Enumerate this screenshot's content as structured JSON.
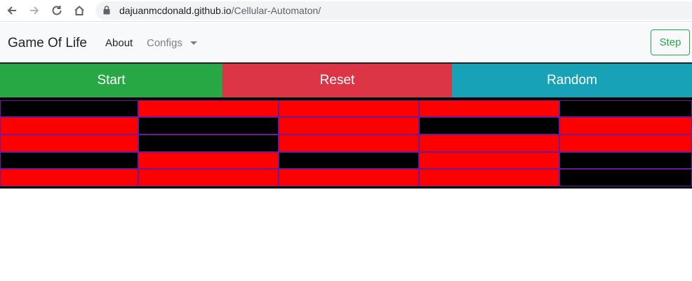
{
  "browser": {
    "url_host": "dajuanmcdonald.github.io",
    "url_path": "/Cellular-Automaton/",
    "icons": [
      "back-arrow-icon",
      "forward-arrow-icon",
      "reload-icon",
      "home-icon",
      "lock-icon"
    ]
  },
  "navbar": {
    "brand": "Game Of Life",
    "about": "About",
    "configs": "Configs",
    "step": "Step",
    "step_color": "#28a745"
  },
  "controls": {
    "start": "Start",
    "reset": "Reset",
    "random": "Random",
    "colors": {
      "start": "#28a745",
      "reset": "#dc3545",
      "random": "#17a2b8"
    }
  },
  "grid": {
    "alive_color": "#ff0000",
    "dead_color": "#000000",
    "rows": [
      [
        0,
        1,
        1,
        1,
        0
      ],
      [
        1,
        0,
        1,
        0,
        1
      ],
      [
        1,
        0,
        1,
        1,
        1
      ],
      [
        0,
        1,
        0,
        1,
        0
      ],
      [
        1,
        1,
        1,
        1,
        0
      ]
    ]
  }
}
